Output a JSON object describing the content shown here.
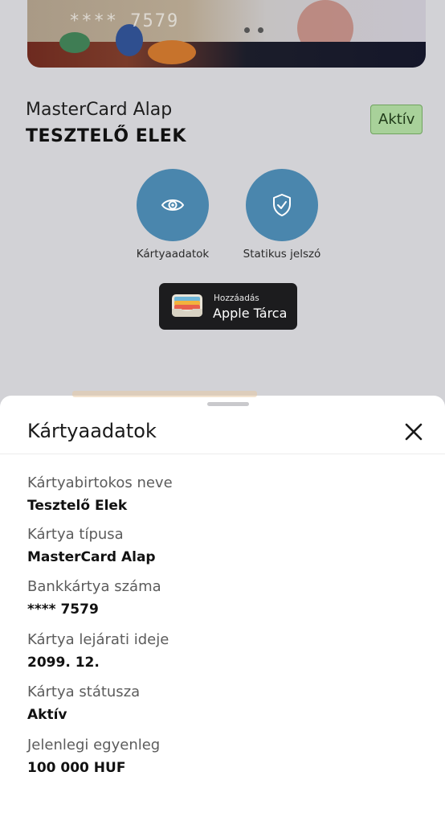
{
  "card": {
    "masked_number": "**** 7579",
    "type_name": "MasterCard Alap",
    "holder_name": "TESZTELŐ ELEK",
    "status_badge": "Aktív"
  },
  "actions": [
    {
      "label": "Kártyaadatok",
      "icon": "eye-icon"
    },
    {
      "label": "Statikus jelszó",
      "icon": "shield-check-icon"
    }
  ],
  "wallet": {
    "small": "Hozzáadás",
    "big": "Apple Tárca",
    "icon": "wallet-icon"
  },
  "sheet": {
    "title": "Kártyaadatok",
    "close_icon": "close-icon",
    "fields": [
      {
        "label": "Kártyabirtokos neve",
        "value": "Tesztelő Elek"
      },
      {
        "label": "Kártya típusa",
        "value": "MasterCard Alap"
      },
      {
        "label": "Bankkártya száma",
        "value": "**** 7579"
      },
      {
        "label": "Kártya lejárati ideje",
        "value": "2099. 12."
      },
      {
        "label": "Kártya státusza",
        "value": "Aktív"
      },
      {
        "label": "Jelenlegi egyenleg",
        "value": "100 000 HUF"
      }
    ]
  },
  "colors": {
    "accent": "#4a86ad",
    "badge_bg": "#a8d19a",
    "overlay_bg": "#d2d2d6"
  }
}
